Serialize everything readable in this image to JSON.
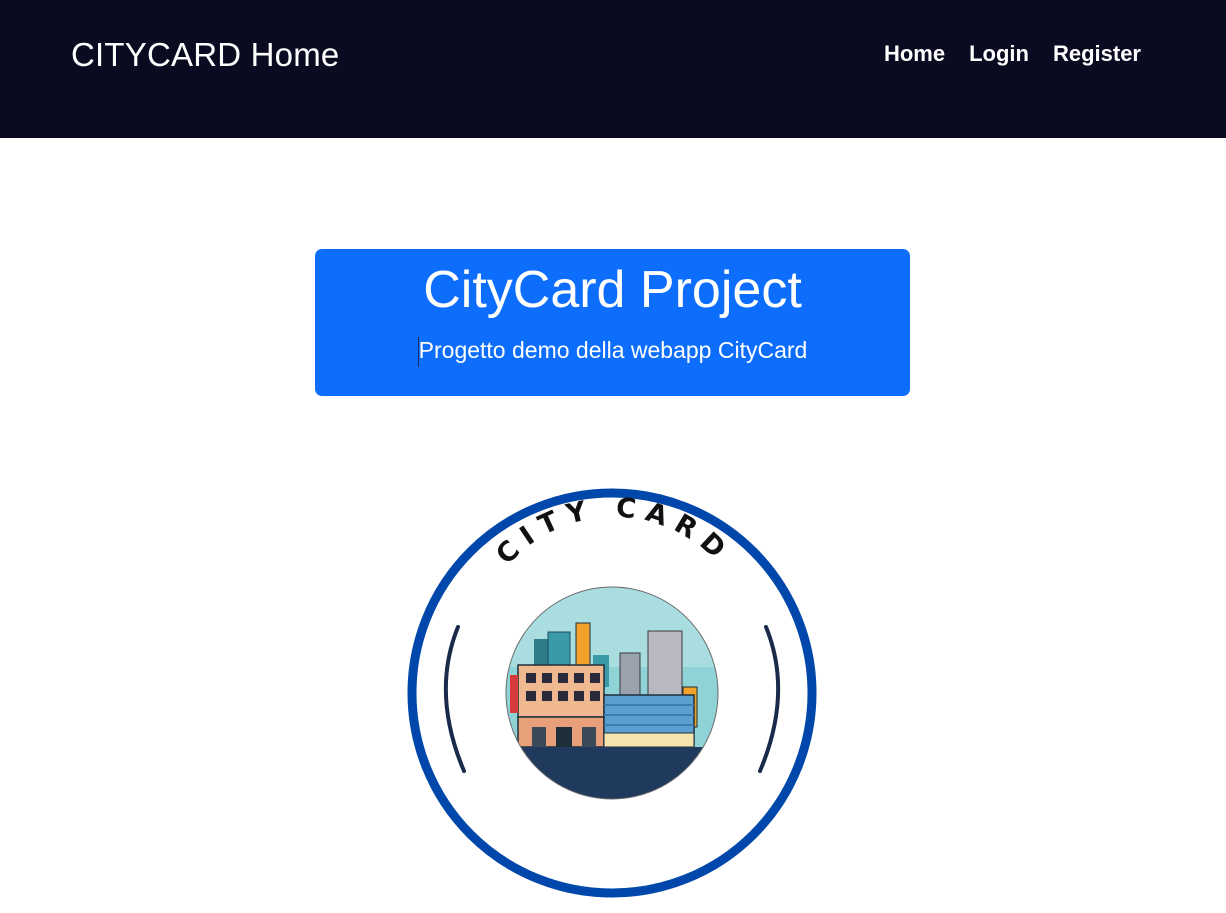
{
  "navbar": {
    "brand": "CITYCARD Home",
    "links": [
      {
        "label": "Home"
      },
      {
        "label": "Login"
      },
      {
        "label": "Register"
      }
    ]
  },
  "hero": {
    "title": "CityCard Project",
    "subtitle": "Progetto demo della webapp CityCard",
    "background": "#0d6efd"
  },
  "logo": {
    "text": "CITY CARD",
    "ring_color": "#0047ab",
    "bracket_color": "#1a2a4a"
  },
  "colors": {
    "navbar_bg": "#0a0b20",
    "accent": "#0d6efd"
  }
}
